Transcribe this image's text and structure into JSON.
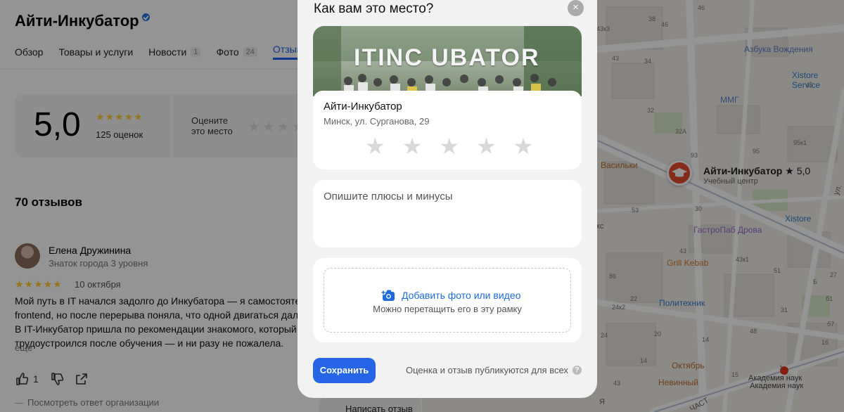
{
  "org": {
    "title": "Айти-Инкубатор",
    "tabs": [
      {
        "label": "Обзор",
        "count": ""
      },
      {
        "label": "Товары и услуги",
        "count": ""
      },
      {
        "label": "Новости",
        "count": "1"
      },
      {
        "label": "Фото",
        "count": "24"
      },
      {
        "label": "Отзывы",
        "count": ""
      }
    ]
  },
  "rating": {
    "value": "5,0",
    "stars": "★★★★★",
    "count_text": "125 оценок",
    "prompt": "Оцените\nэто место",
    "empty_stars": "★★★★★"
  },
  "reviews": {
    "count_text": "70 отзывов",
    "items": [
      {
        "name": "Елена Дружинина",
        "level": "Знаток города 3 уровня",
        "stars": "★★★★★",
        "date": "10 октября",
        "text": "Мой путь в IT начался задолго до Инкубатора — я самостоятельно изучала\nfrontend, но после перерыва поняла, что одной двигаться дальше сложно.\nВ IT-Инкубатор пришла по рекомендации знакомого, который\nтрудоустроился после обучения — и ни разу не пожалела.",
        "more": "ещё",
        "likes": "1",
        "org_reply": "Посмотреть ответ организации"
      }
    ],
    "write_button": "Написать отзыв"
  },
  "map": {
    "marker_name": "Айти-Инкубатор",
    "marker_rating": "★ 5,0",
    "marker_category": "Учебный центр",
    "pois": [
      {
        "label": "Азбука Вождения",
        "color": "#5b7fc9"
      },
      {
        "label": "Xistore Service",
        "color": "#2d7fd4"
      },
      {
        "label": "ММГ",
        "color": "#5b7fc9"
      },
      {
        "label": "Васильки",
        "color": "#c06a2a"
      },
      {
        "label": "Xistore",
        "color": "#2d7fd4"
      },
      {
        "label": "ГастроПаб Дрова",
        "color": "#9a6ad0"
      },
      {
        "label": "Grill Kebab",
        "color": "#d17a2a"
      },
      {
        "label": "Политехник",
        "color": "#2d7fd4"
      },
      {
        "label": "Октябрь",
        "color": "#c06a2a"
      },
      {
        "label": "Невинный",
        "color": "#c06a2a"
      },
      {
        "label": "Академия наук",
        "color": "#444444"
      },
      {
        "label": "Академия наук",
        "color": "#444444"
      }
    ],
    "house_numbers": [
      "43к3",
      "46",
      "38",
      "46",
      "34",
      "43",
      "32",
      "32А",
      "95к1",
      "45",
      "93",
      "95",
      "53",
      "30",
      "43",
      "43к1",
      "86",
      "22",
      "31",
      "24к2",
      "24",
      "20",
      "48",
      "51",
      "14",
      "15",
      "1",
      "27",
      "Б",
      "43",
      "б1",
      "б7",
      "16",
      "14"
    ],
    "street_names": [
      "кс",
      "ул.",
      "Я",
      "ЧАСТ"
    ]
  },
  "modal": {
    "title": "Как вам это место?",
    "close_symbol": "×",
    "photo_sign": "ITINC UBATOR",
    "place_name": "Айти-Инкубатор",
    "place_address": "Минск, ул. Сурганова, 29",
    "stars": [
      "★",
      "★",
      "★",
      "★",
      "★"
    ],
    "review_placeholder": "Опишите плюсы и минусы",
    "add_photo_label": "Добавить фото или видео",
    "drop_hint": "Можно перетащить его в эту рамку",
    "save_label": "Сохранить",
    "footer_note": "Оценка и отзыв публикуются для всех",
    "help_symbol": "?"
  },
  "colors": {
    "accent": "#2565e6",
    "link": "#1f6ae0",
    "star_filled": "#ffcc33",
    "star_empty": "#d8d8d8",
    "marker": "#e54b2e"
  }
}
